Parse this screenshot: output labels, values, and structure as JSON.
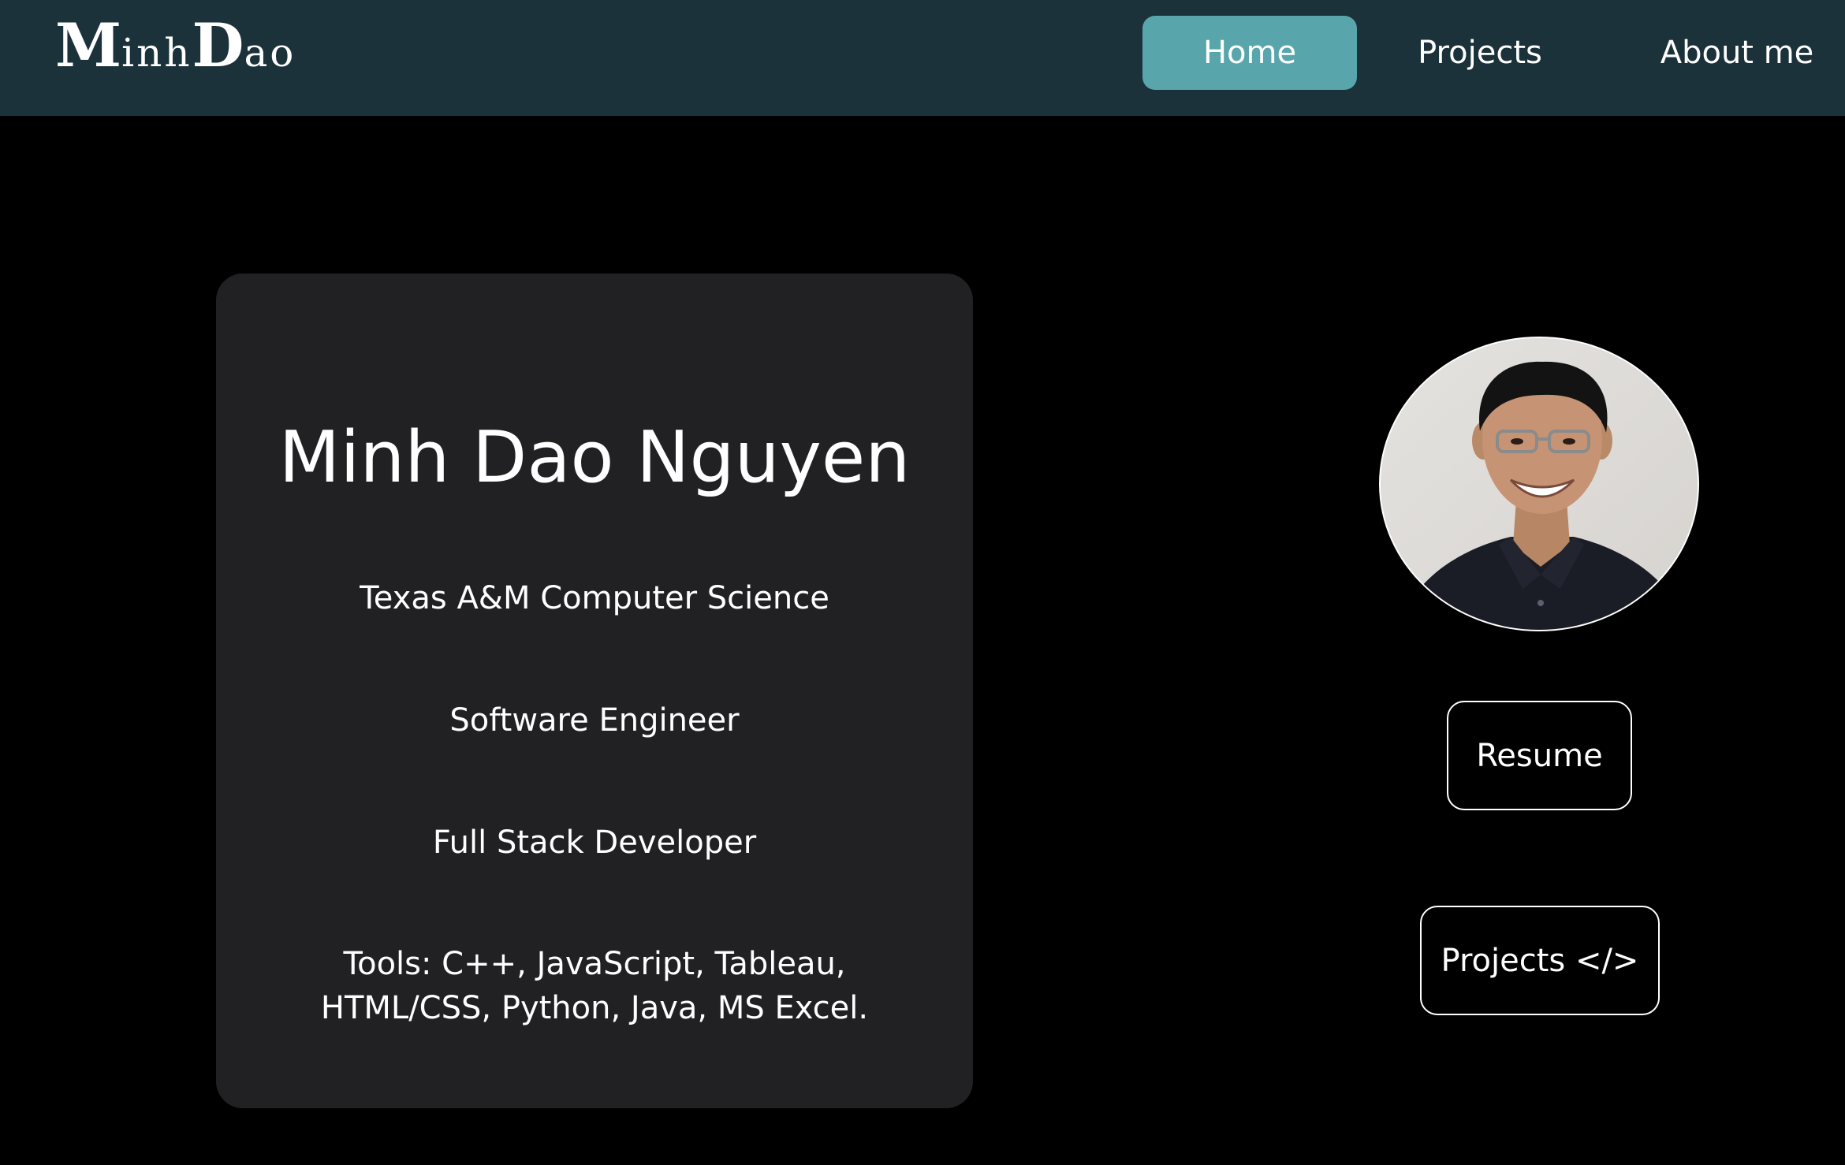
{
  "navbar": {
    "logo": {
      "part1_initial": "M",
      "part1_rest": "inh",
      "part2_initial": "D",
      "part2_rest": "ao"
    },
    "links": {
      "home": "Home",
      "projects": "Projects",
      "about": "About me"
    },
    "active_link": "Home",
    "background_color": "#1c323b",
    "active_color": "#58a6ac"
  },
  "profile": {
    "name": "Minh Dao Nguyen",
    "lines": [
      "Texas A&M Computer Science",
      "Software Engineer",
      "Full Stack Developer",
      "Tools: C++, JavaScript, Tableau, HTML/CSS, Python, Java, MS Excel."
    ],
    "card_color": "#212123"
  },
  "actions": {
    "resume": "Resume",
    "projects": "Projects </>"
  }
}
